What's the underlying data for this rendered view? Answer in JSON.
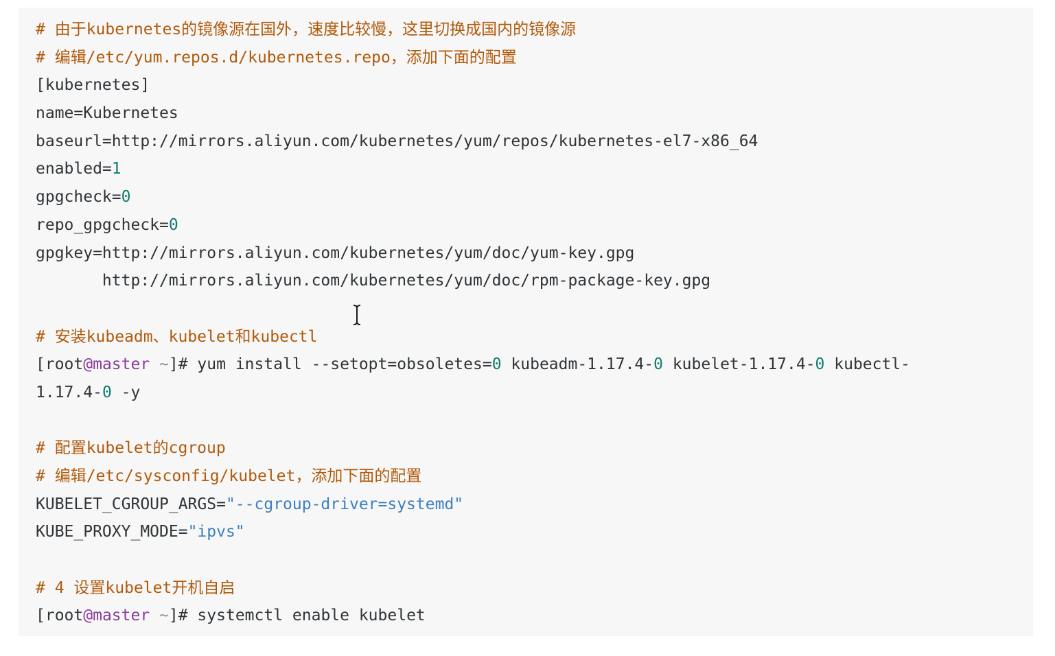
{
  "code_block": {
    "lines": [
      [
        {
          "t": "# 由于kubernetes的镜像源在国外，速度比较慢，这里切换成国内的镜像源",
          "c": "comment"
        }
      ],
      [
        {
          "t": "# 编辑/etc/yum.repos.d/kubernetes.repo，添加下面的配置",
          "c": "comment"
        }
      ],
      [
        {
          "t": "[kubernetes]",
          "c": "plain"
        }
      ],
      [
        {
          "t": "name=Kubernetes",
          "c": "plain"
        }
      ],
      [
        {
          "t": "baseurl=http://mirrors.aliyun.com/kubernetes/yum/repos/kubernetes-el7-x86_64",
          "c": "plain"
        }
      ],
      [
        {
          "t": "enabled=",
          "c": "plain"
        },
        {
          "t": "1",
          "c": "num"
        }
      ],
      [
        {
          "t": "gpgcheck=",
          "c": "plain"
        },
        {
          "t": "0",
          "c": "num"
        }
      ],
      [
        {
          "t": "repo_gpgcheck=",
          "c": "plain"
        },
        {
          "t": "0",
          "c": "num"
        }
      ],
      [
        {
          "t": "gpgkey=http://mirrors.aliyun.com/kubernetes/yum/doc/yum-key.gpg",
          "c": "plain"
        }
      ],
      [
        {
          "t": "       http://mirrors.aliyun.com/kubernetes/yum/doc/rpm-package-key.gpg",
          "c": "plain"
        }
      ],
      [],
      [
        {
          "t": "# 安装kubeadm、kubelet和kubectl",
          "c": "comment"
        }
      ],
      [
        {
          "t": "[root",
          "c": "plain"
        },
        {
          "t": "@master",
          "c": "prompt-key"
        },
        {
          "t": " ~",
          "c": "prompt-dim"
        },
        {
          "t": "]# yum install --setopt=obsoletes=",
          "c": "plain"
        },
        {
          "t": "0",
          "c": "num"
        },
        {
          "t": " kubeadm-1.17.4-",
          "c": "plain"
        },
        {
          "t": "0",
          "c": "num"
        },
        {
          "t": " kubelet-1.17.4-",
          "c": "plain"
        },
        {
          "t": "0",
          "c": "num"
        },
        {
          "t": " kubectl-",
          "c": "plain"
        }
      ],
      [
        {
          "t": "1.17.4-",
          "c": "plain"
        },
        {
          "t": "0",
          "c": "num"
        },
        {
          "t": " -y",
          "c": "plain"
        }
      ],
      [],
      [
        {
          "t": "# 配置kubelet的cgroup",
          "c": "comment"
        }
      ],
      [
        {
          "t": "# 编辑/etc/sysconfig/kubelet，添加下面的配置",
          "c": "comment"
        }
      ],
      [
        {
          "t": "KUBELET_CGROUP_ARGS=",
          "c": "plain"
        },
        {
          "t": "\"--cgroup-driver=systemd\"",
          "c": "str"
        }
      ],
      [
        {
          "t": "KUBE_PROXY_MODE=",
          "c": "plain"
        },
        {
          "t": "\"ipvs\"",
          "c": "str"
        }
      ],
      [],
      [
        {
          "t": "# 4 设置kubelet开机自启",
          "c": "comment"
        }
      ],
      [
        {
          "t": "[root",
          "c": "plain"
        },
        {
          "t": "@master",
          "c": "prompt-key"
        },
        {
          "t": " ~",
          "c": "prompt-dim"
        },
        {
          "t": "]# systemctl enable kubelet",
          "c": "plain"
        }
      ]
    ]
  },
  "cursor": {
    "icon": "text-cursor-icon"
  }
}
